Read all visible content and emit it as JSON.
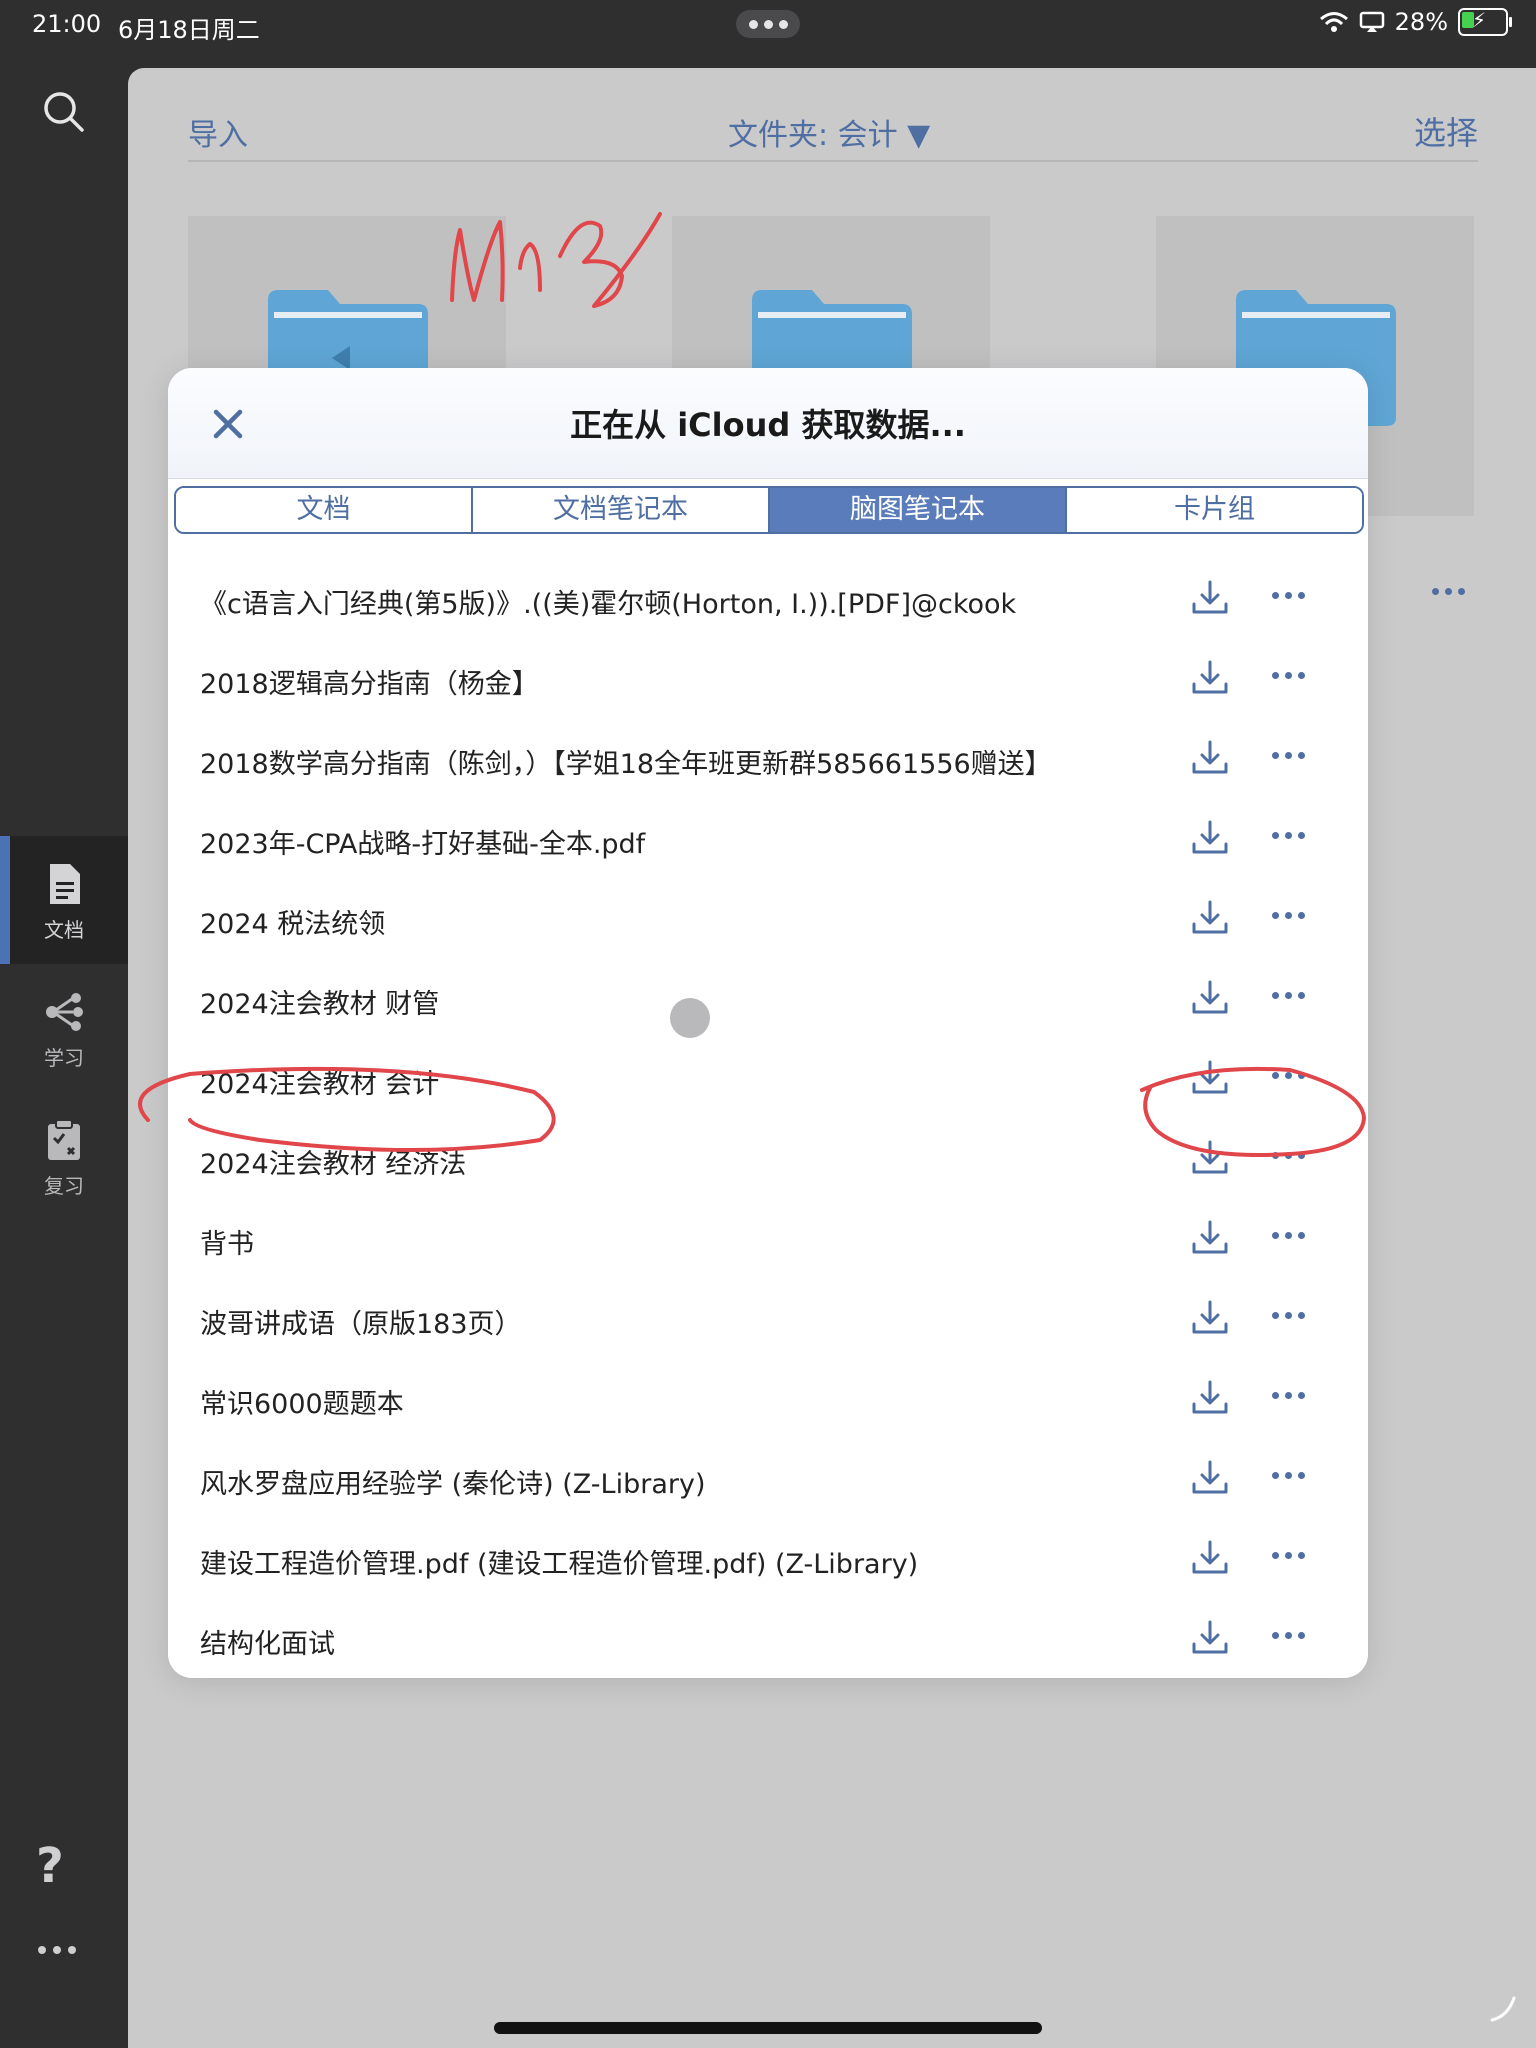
{
  "status_bar": {
    "time": "21:00",
    "date": "6月18日周二",
    "battery": "28%",
    "battery_level": 0.28
  },
  "sidebar": {
    "items": [
      {
        "label": "文档",
        "active": true
      },
      {
        "label": "学习",
        "active": false
      },
      {
        "label": "复习",
        "active": false
      }
    ],
    "help": "?"
  },
  "toolbar": {
    "import": "导入",
    "folder": "文件夹: 会计 ▼",
    "select": "选择"
  },
  "modal": {
    "title": "正在从 iCloud 获取数据...",
    "tabs": [
      {
        "label": "文档",
        "active": false
      },
      {
        "label": "文档笔记本",
        "active": false
      },
      {
        "label": "脑图笔记本",
        "active": true
      },
      {
        "label": "卡片组",
        "active": false
      }
    ],
    "items": [
      "《c语言入门经典(第5版)》.((美)霍尔顿(Horton, I.)).[PDF]@ckook",
      "2018逻辑高分指南（杨金】",
      "2018数学高分指南（陈剑，）【学姐18全年班更新群585661556赠送】",
      "2023年-CPA战略-打好基础-全本.pdf",
      "2024 税法统领",
      "2024注会教材 财管",
      "2024注会教材 会计",
      "2024注会教材 经济法",
      "背书",
      "波哥讲成语（原版183页）",
      "常识6000题题本",
      "风水罗盘应用经验学 (秦伦诗) (Z-Library)",
      "建设工程造价管理.pdf (建设工程造价管理.pdf) (Z-Library)",
      "结构化面试"
    ]
  },
  "colors": {
    "accent": "#4f6fa3",
    "tab_active": "#5b7cbb",
    "annotation": "#e0464a"
  }
}
